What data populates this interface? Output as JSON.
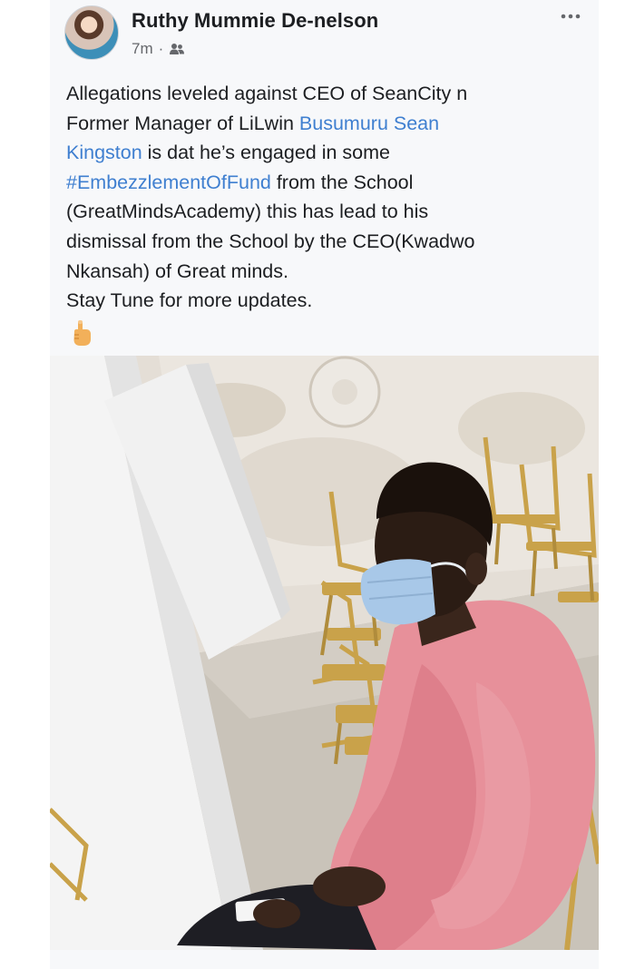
{
  "post": {
    "author": "Ruthy Mummie De-nelson",
    "time": "7m",
    "separator": "·",
    "audience_icon": "friends-icon",
    "more_icon": "more-options-icon",
    "more_label": "•••",
    "text": {
      "line1": "Allegations leveled against CEO of SeanCity n",
      "line2_a": "Former Manager of LiLwin ",
      "mention_a": "Busumuru Sean",
      "mention_b": "Kingston",
      "line3_rest": " is dat he’s engaged in some",
      "hashtag": "#EmbezzlementOfFund",
      "line4_rest": " from the School",
      "line5": "(GreatMindsAcademy) this has lead to his",
      "line6": "dismissal from the School by the CEO(Kwadwo",
      "line7": "Nkansah)  of Great minds.",
      "line8": "Stay Tune for more updates."
    },
    "emoji_icon": "pointing-up-hand-icon",
    "photo": {
      "description_icon": "post-photo"
    }
  },
  "colors": {
    "link": "#3f7fd0",
    "text": "#1c1e21",
    "meta": "#65676b",
    "shirt": "#e7909a",
    "mask": "#a8c8e8"
  }
}
